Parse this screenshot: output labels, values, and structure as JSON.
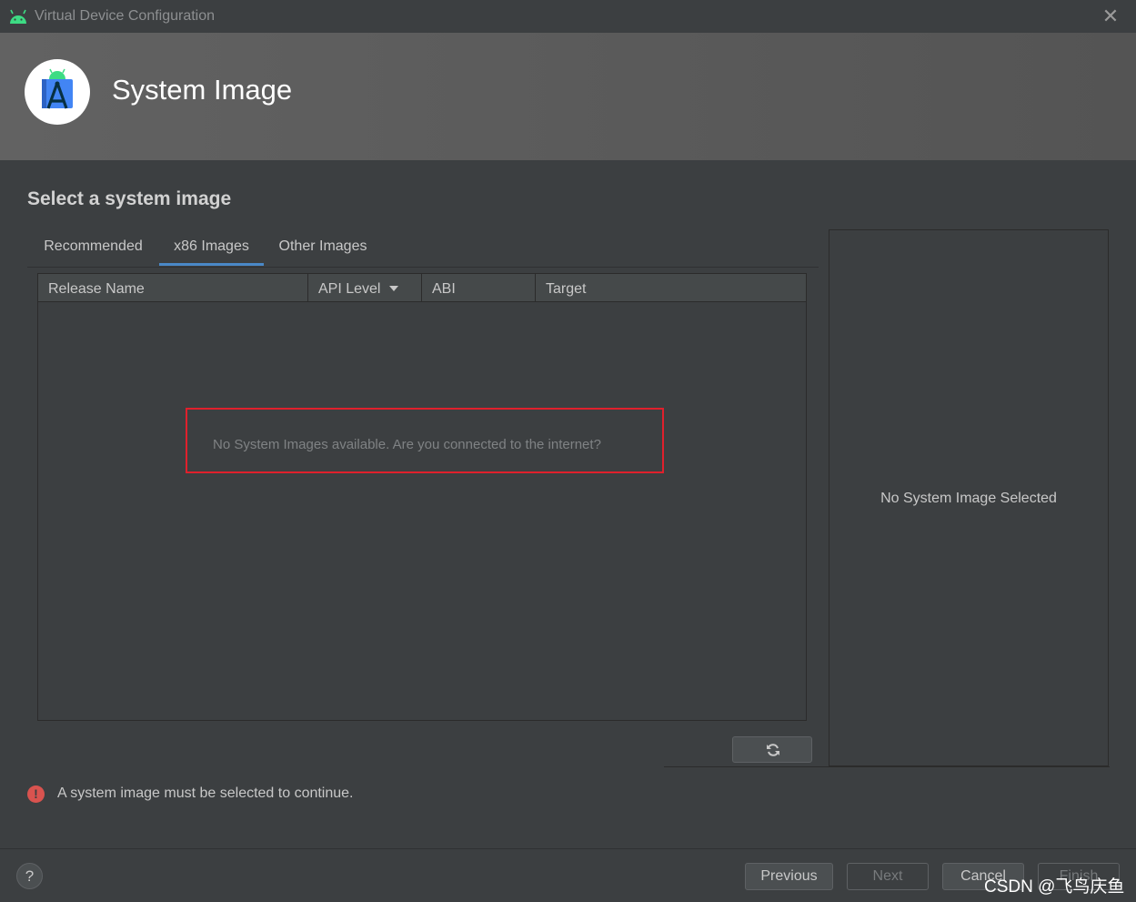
{
  "window": {
    "title": "Virtual Device Configuration",
    "close_label": "✕"
  },
  "header": {
    "title": "System Image"
  },
  "page": {
    "subtitle": "Select a system image"
  },
  "tabs": [
    {
      "label": "Recommended",
      "active": false
    },
    {
      "label": "x86 Images",
      "active": true
    },
    {
      "label": "Other Images",
      "active": false
    }
  ],
  "table": {
    "columns": [
      "Release Name",
      "API Level",
      "ABI",
      "Target"
    ],
    "sorted_column": "API Level",
    "empty_message": "No System Images available. Are you connected to the internet?"
  },
  "detail": {
    "empty_text": "No System Image Selected"
  },
  "error": {
    "icon": "!",
    "message": "A system image must be selected to continue."
  },
  "footer": {
    "help_label": "?",
    "previous_label": "Previous",
    "next_label": "Next",
    "cancel_label": "Cancel",
    "finish_label": "Finish"
  },
  "watermark": "CSDN @飞鸟庆鱼",
  "colors": {
    "accent": "#4a88c7",
    "highlight_border": "#e0202c",
    "error": "#d9534f",
    "android_green": "#3ddc84"
  }
}
